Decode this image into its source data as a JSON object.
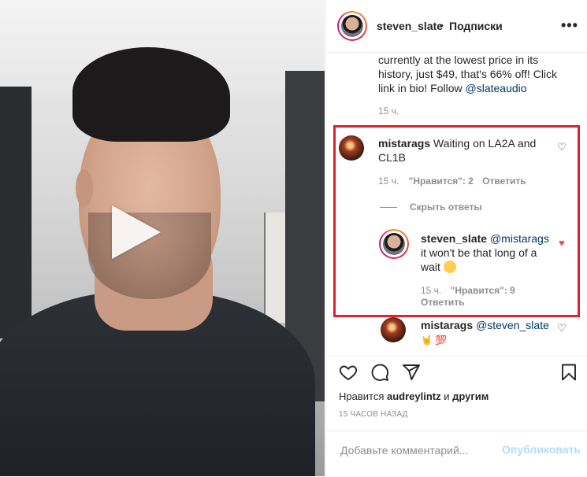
{
  "post": {
    "username": "steven_slate",
    "separator": "•",
    "follow_label": "Подписки",
    "more_icon": "more-horizontal-icon"
  },
  "caption": {
    "text_line_a": "currently at the lowest price in its",
    "text_line_b": "history, just $49, that's 66% off! Click",
    "text_line_c": "link in bio! Follow ",
    "mention": "@slateaudio",
    "time": "15 ч."
  },
  "comments": [
    {
      "username": "mistarags",
      "text_a": " Waiting on LA2A and",
      "text_b": "CL1B",
      "time": "15 ч.",
      "likes": "\"Нравится\": 2",
      "reply_label": "Ответить",
      "liked": false
    }
  ],
  "hide_replies_label": "Скрыть ответы",
  "reply": {
    "username": "steven_slate",
    "mention": "@mistarags",
    "text_a": "it won't be that long of a",
    "text_b": "wait ",
    "time": "15 ч.",
    "likes": "\"Нравится\": 9",
    "reply_label": "Ответить",
    "liked": true
  },
  "reply2": {
    "username": "mistarags",
    "mention": "@steven_slate",
    "emoji_text": "🤘 💯"
  },
  "actions": {
    "liked_by_prefix": "Нравится ",
    "liked_by_user": "audreylintz",
    "liked_by_and": " и ",
    "liked_by_others": "другим",
    "timestamp": "15 ЧАСОВ НАЗАД"
  },
  "composer": {
    "placeholder": "Добавьте комментарий...",
    "publish_label": "Опубликовать"
  },
  "colors": {
    "highlight_border": "#e0202a",
    "like_red": "#ed4956",
    "link_blue": "#00376b",
    "publish_disabled": "#b3dbff"
  }
}
